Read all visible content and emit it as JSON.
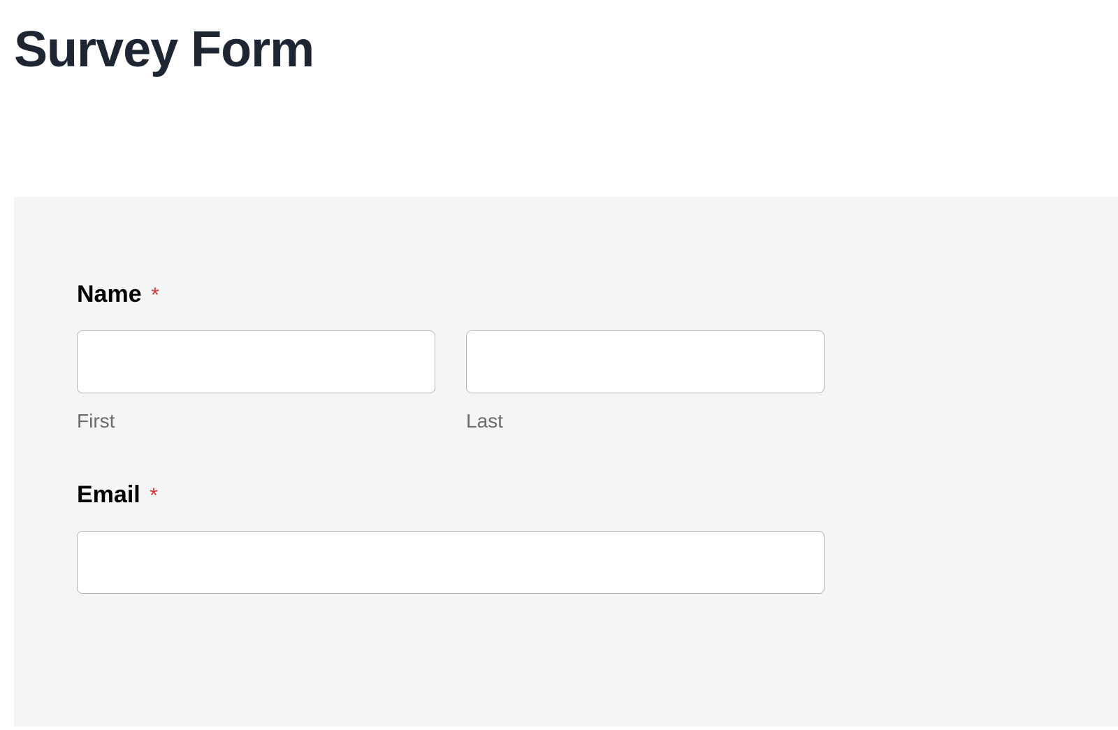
{
  "page": {
    "title": "Survey Form"
  },
  "form": {
    "name": {
      "label": "Name",
      "required_marker": "*",
      "first": {
        "sublabel": "First",
        "value": ""
      },
      "last": {
        "sublabel": "Last",
        "value": ""
      }
    },
    "email": {
      "label": "Email",
      "required_marker": "*",
      "value": ""
    }
  }
}
